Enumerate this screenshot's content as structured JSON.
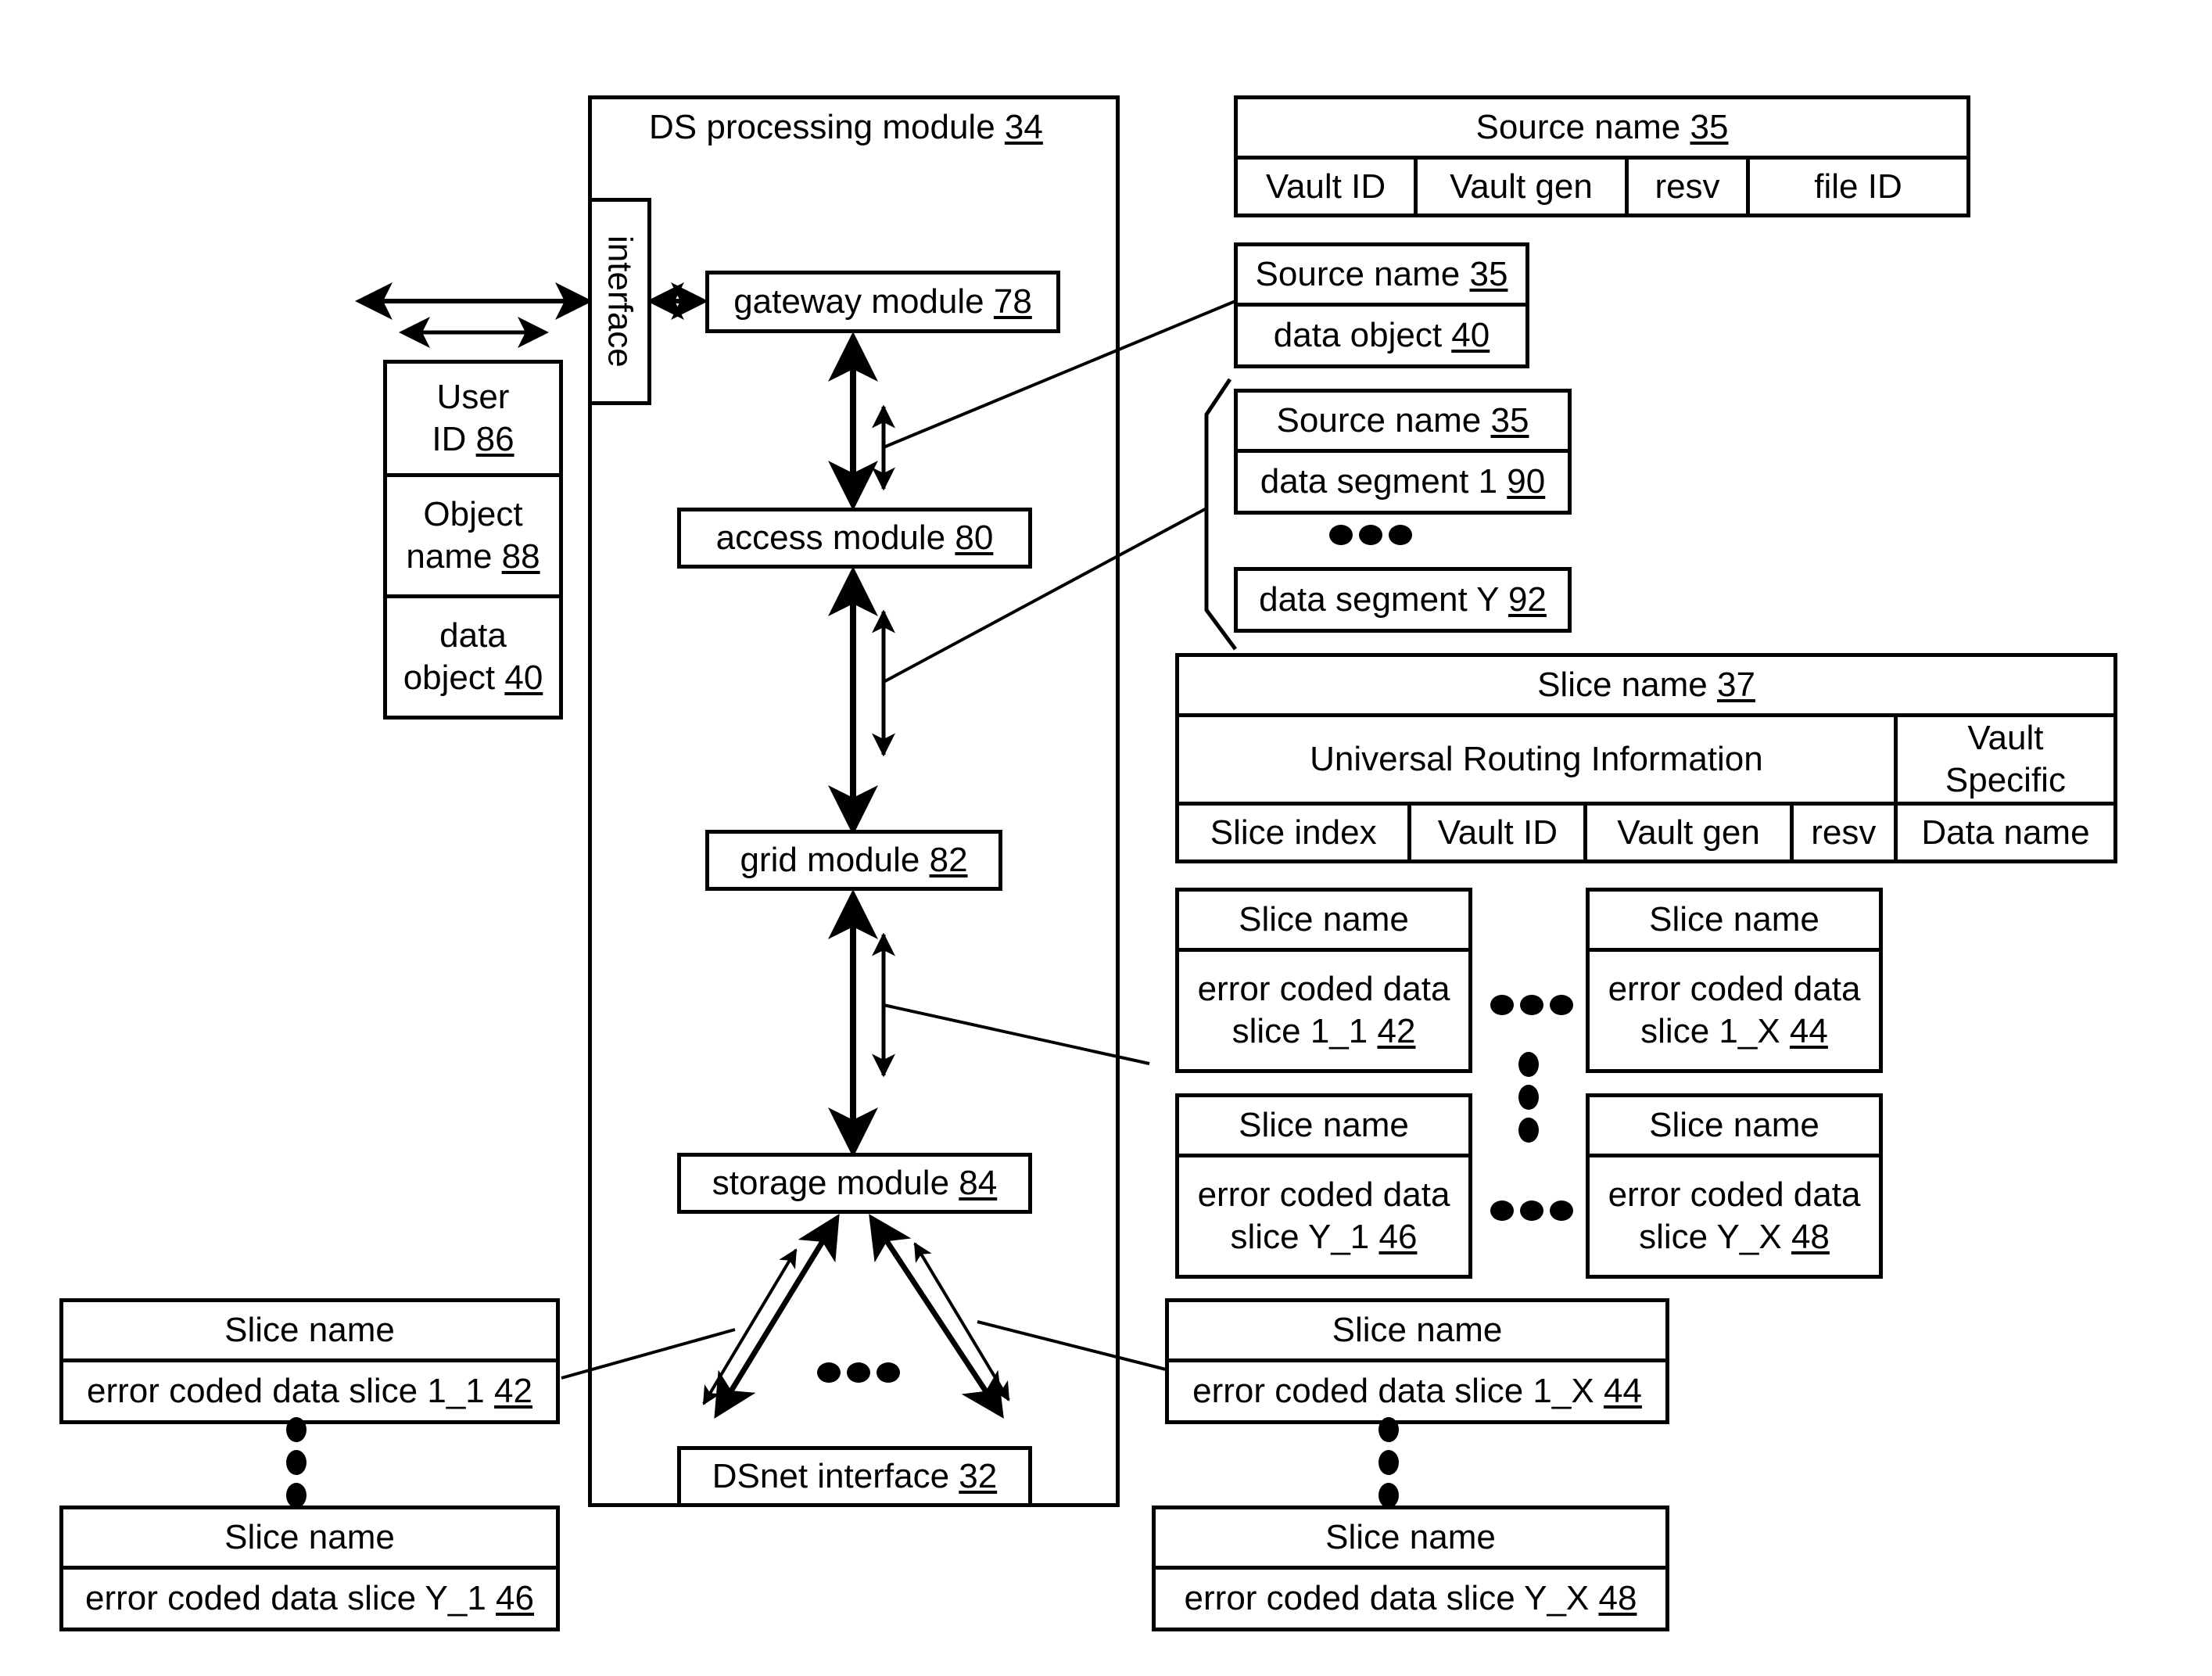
{
  "ds_module": {
    "title": "DS processing module ",
    "title_ref": "34",
    "interface": "interface",
    "gateway": {
      "label": "gateway module ",
      "ref": "78"
    },
    "access": {
      "label": "access module ",
      "ref": "80"
    },
    "grid": {
      "label": "grid module ",
      "ref": "82"
    },
    "storage": {
      "label": "storage module ",
      "ref": "84"
    },
    "dsnet": {
      "label": "DSnet interface ",
      "ref": "32"
    }
  },
  "user_stack": [
    {
      "line1": "User",
      "line2": "ID ",
      "ref": "86"
    },
    {
      "line1": "Object",
      "line2": "name ",
      "ref": "88"
    },
    {
      "line1": "data",
      "line2": "object ",
      "ref": "40"
    }
  ],
  "source_name_table": {
    "header": "Source name ",
    "ref": "35",
    "fields": [
      "Vault ID",
      "Vault gen",
      "resv",
      "file ID"
    ]
  },
  "data_object_box": {
    "header": "Source name ",
    "header_ref": "35",
    "body": "data object ",
    "body_ref": "40"
  },
  "segment_box_1": {
    "header": "Source name ",
    "header_ref": "35",
    "body": "data segment 1 ",
    "body_ref": "90"
  },
  "segment_box_y": {
    "body": "data segment Y ",
    "body_ref": "92"
  },
  "slice_name_table": {
    "header": "Slice name ",
    "ref": "37",
    "universal": "Universal Routing Information",
    "vault_specific": "Vault Specific",
    "fields": [
      "Slice index",
      "Vault ID",
      "Vault gen",
      "resv",
      "Data name"
    ]
  },
  "slice_grid": [
    {
      "header": "Slice name",
      "line1": "error coded data",
      "line2": "slice 1_1 ",
      "ref": "42"
    },
    {
      "header": "Slice name",
      "line1": "error coded data",
      "line2": "slice 1_X ",
      "ref": "44"
    },
    {
      "header": "Slice name",
      "line1": "error coded data",
      "line2": "slice Y_1 ",
      "ref": "46"
    },
    {
      "header": "Slice name",
      "line1": "error coded data",
      "line2": "slice Y_X ",
      "ref": "48"
    }
  ],
  "bottom_slices": {
    "left_top": {
      "header": "Slice name",
      "body": "error coded data slice 1_1 ",
      "ref": "42"
    },
    "left_bottom": {
      "header": "Slice name",
      "body": "error coded data slice Y_1 ",
      "ref": "46"
    },
    "right_top": {
      "header": "Slice name",
      "body": "error coded data slice 1_X ",
      "ref": "44"
    },
    "right_bottom": {
      "header": "Slice name",
      "body": "error coded data slice Y_X ",
      "ref": "48"
    }
  }
}
